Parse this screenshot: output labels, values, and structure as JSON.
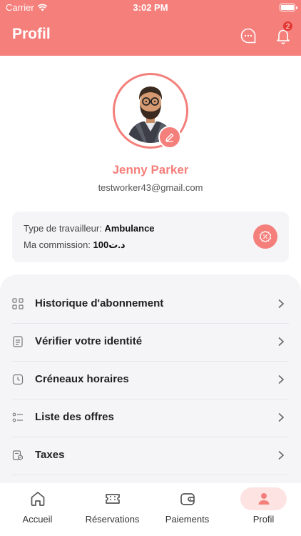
{
  "status_bar": {
    "carrier": "Carrier",
    "time": "3:02 PM"
  },
  "header": {
    "title": "Profil",
    "notification_count": "2",
    "accent_color": "#f47f7b"
  },
  "profile": {
    "name": "Jenny Parker",
    "email": "testworker43@gmail.com"
  },
  "info": {
    "worker_type_label": "Type de travailleur: ",
    "worker_type_value": "Ambulance",
    "commission_label": "Ma commission: ",
    "commission_value": "100د.ت"
  },
  "menu": {
    "items": [
      {
        "label": "Historique d'abonnement",
        "icon": "grid-icon"
      },
      {
        "label": "Vérifier votre identité",
        "icon": "document-icon"
      },
      {
        "label": "Créneaux horaires",
        "icon": "clock-icon"
      },
      {
        "label": "Liste des offres",
        "icon": "list-icon"
      },
      {
        "label": "Taxes",
        "icon": "tax-icon"
      }
    ]
  },
  "tabs": [
    {
      "label": "Accueil",
      "icon": "home-icon"
    },
    {
      "label": "Réservations",
      "icon": "ticket-icon"
    },
    {
      "label": "Paiements",
      "icon": "wallet-icon"
    },
    {
      "label": "Profil",
      "icon": "user-icon",
      "active": true
    }
  ]
}
